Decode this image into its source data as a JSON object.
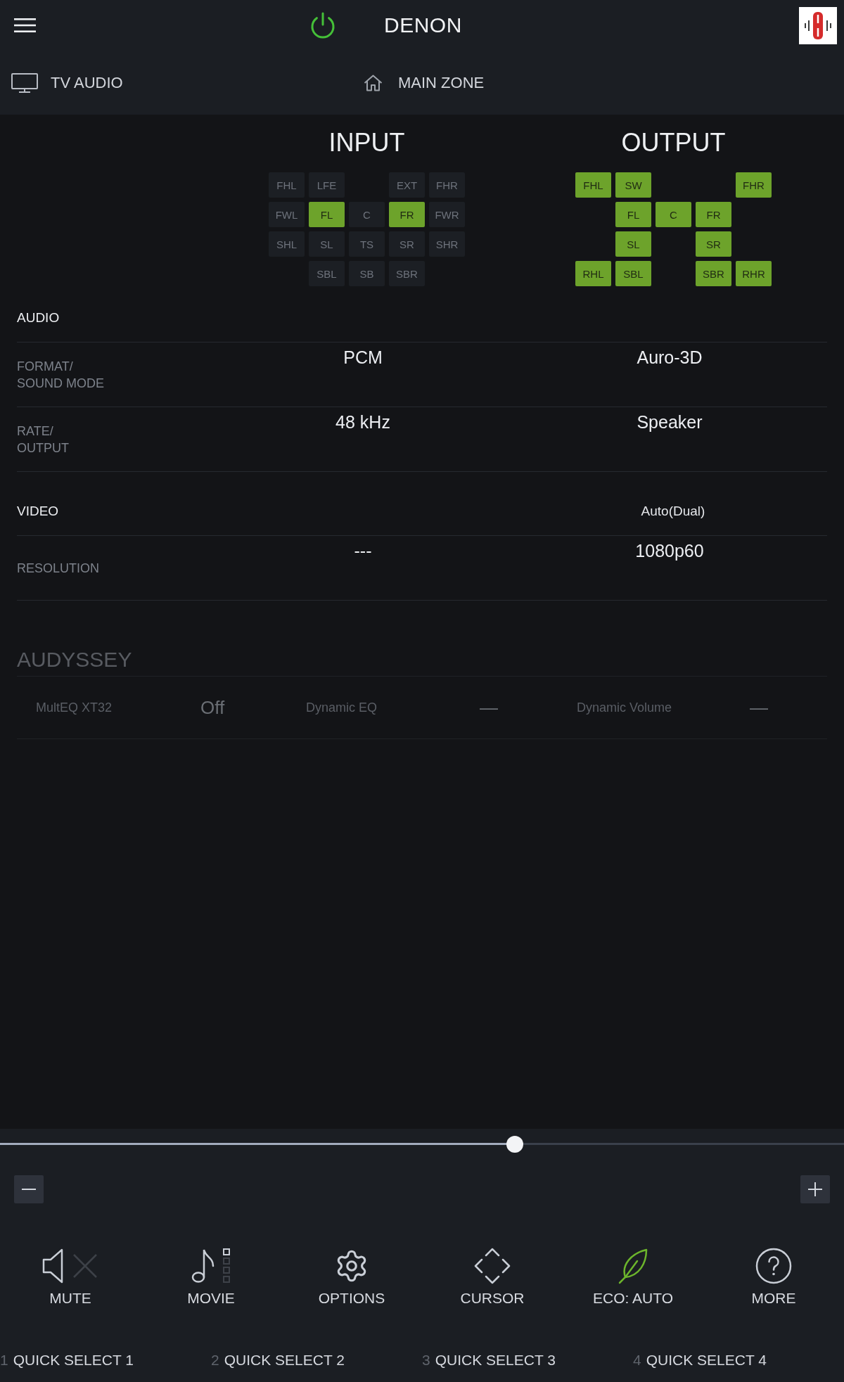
{
  "header": {
    "brand": "DENON",
    "power": {
      "on": true
    },
    "source": "TV AUDIO",
    "zone": "MAIN ZONE"
  },
  "input": {
    "title": "INPUT",
    "rows": [
      [
        {
          "label": "FHL",
          "active": false
        },
        {
          "label": "LFE",
          "active": false
        },
        null,
        {
          "label": "EXT",
          "active": false
        },
        {
          "label": "FHR",
          "active": false
        }
      ],
      [
        {
          "label": "FWL",
          "active": false
        },
        {
          "label": "FL",
          "active": true
        },
        {
          "label": "C",
          "active": false
        },
        {
          "label": "FR",
          "active": true
        },
        {
          "label": "FWR",
          "active": false
        }
      ],
      [
        {
          "label": "SHL",
          "active": false
        },
        {
          "label": "SL",
          "active": false
        },
        {
          "label": "TS",
          "active": false
        },
        {
          "label": "SR",
          "active": false
        },
        {
          "label": "SHR",
          "active": false
        }
      ],
      [
        null,
        {
          "label": "SBL",
          "active": false
        },
        {
          "label": "SB",
          "active": false
        },
        {
          "label": "SBR",
          "active": false
        },
        null
      ]
    ]
  },
  "output": {
    "title": "OUTPUT",
    "rows": [
      [
        {
          "label": "FHL",
          "active": true
        },
        {
          "label": "SW",
          "active": true
        },
        null,
        null,
        {
          "label": "FHR",
          "active": true
        }
      ],
      [
        null,
        {
          "label": "FL",
          "active": true
        },
        {
          "label": "C",
          "active": true
        },
        {
          "label": "FR",
          "active": true
        },
        null
      ],
      [
        null,
        {
          "label": "SL",
          "active": true
        },
        null,
        {
          "label": "SR",
          "active": true
        },
        null
      ],
      [
        {
          "label": "RHL",
          "active": true
        },
        {
          "label": "SBL",
          "active": true
        },
        null,
        {
          "label": "SBR",
          "active": true
        },
        {
          "label": "RHR",
          "active": true
        }
      ]
    ]
  },
  "sections": [
    {
      "title": "AUDIO",
      "rows": [
        {
          "label": "FORMAT/\nSOUND MODE",
          "input": "PCM",
          "output": "Auro-3D"
        },
        {
          "label": "RATE/\nOUTPUT",
          "input": "48 kHz",
          "output": "Speaker"
        }
      ]
    },
    {
      "title": "VIDEO",
      "output_note": "Auto(Dual)",
      "rows": [
        {
          "label": "RESOLUTION",
          "input": "---",
          "output": "1080p60"
        }
      ]
    }
  ],
  "audyssey": {
    "title": "AUDYSSEY",
    "disabled": true,
    "settings": [
      {
        "label": "MultEQ XT32",
        "value": "Off"
      },
      {
        "label": "Dynamic EQ",
        "value": "—"
      },
      {
        "label": "Dynamic Volume",
        "value": "—"
      }
    ]
  },
  "volume": {
    "level": 0.61
  },
  "actions": [
    {
      "kind": "mute",
      "label": "MUTE",
      "active": false
    },
    {
      "kind": "movie",
      "label": "MOVIE",
      "active": false
    },
    {
      "kind": "options",
      "label": "OPTIONS",
      "active": false
    },
    {
      "kind": "cursor",
      "label": "CURSOR",
      "active": false
    },
    {
      "kind": "eco",
      "label": "ECO: AUTO",
      "active": true
    },
    {
      "kind": "more",
      "label": "MORE",
      "active": false
    }
  ],
  "quick_selects": [
    {
      "number": "1",
      "label": "QUICK SELECT 1"
    },
    {
      "number": "2",
      "label": "QUICK SELECT 2"
    },
    {
      "number": "3",
      "label": "QUICK SELECT 3"
    },
    {
      "number": "4",
      "label": "QUICK SELECT 4"
    }
  ]
}
